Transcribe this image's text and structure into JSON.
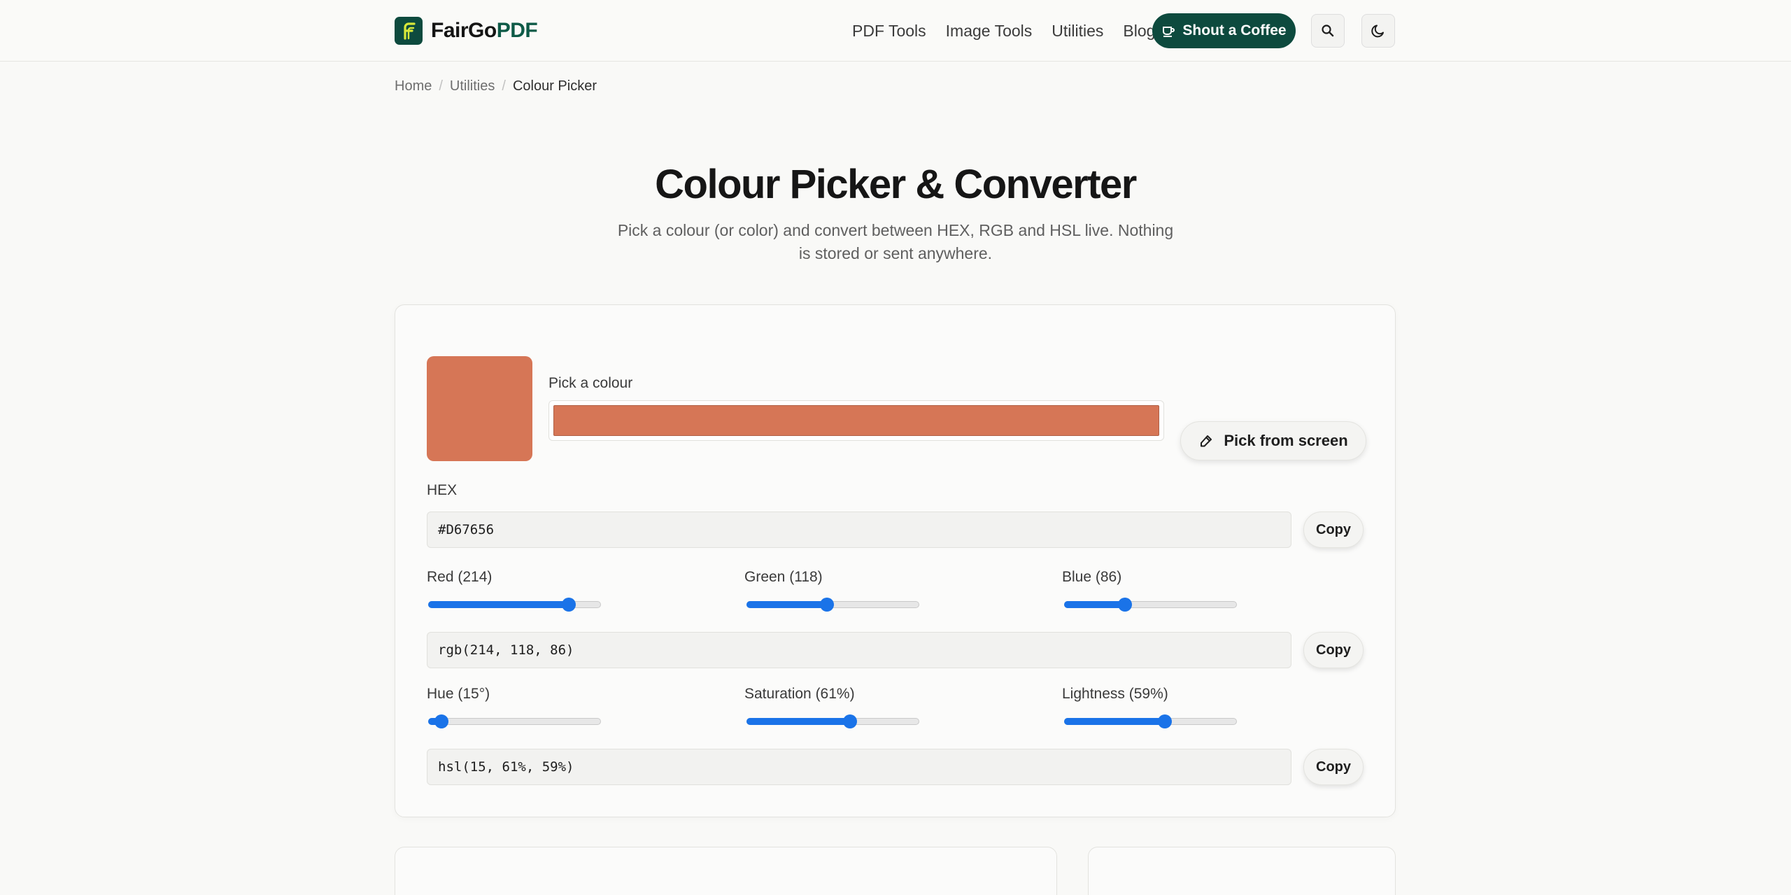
{
  "header": {
    "logo_fair": "FairGo",
    "logo_pdf": "PDF",
    "nav": [
      "PDF Tools",
      "Image Tools",
      "Utilities",
      "Blog"
    ],
    "coffee_label": "Shout a Coffee",
    "search_icon": "search-icon",
    "theme_icon": "moon-icon"
  },
  "breadcrumb": {
    "items": [
      "Home",
      "Utilities"
    ],
    "current": "Colour Picker",
    "separator": "/"
  },
  "hero": {
    "title": "Colour Picker & Converter",
    "subtitle": "Pick a colour (or color) and convert between HEX, RGB and HSL live. Nothing is stored or sent anywhere."
  },
  "picker": {
    "current_color": "#D67656",
    "pick_label": "Pick a colour",
    "pick_screen_label": "Pick from screen",
    "hex_label": "HEX",
    "hex_value": "#D67656",
    "rgb_value": "rgb(214, 118, 86)",
    "hsl_value": "hsl(15, 61%, 59%)",
    "copy_label": "Copy",
    "rgb_sliders": [
      {
        "label": "Red (214)",
        "value": 214,
        "max": 255
      },
      {
        "label": "Green (118)",
        "value": 118,
        "max": 255
      },
      {
        "label": "Blue (86)",
        "value": 86,
        "max": 255
      }
    ],
    "hsl_sliders": [
      {
        "label": "Hue (15°)",
        "value": 15,
        "max": 360
      },
      {
        "label": "Saturation (61%)",
        "value": 61,
        "max": 100
      },
      {
        "label": "Lightness (59%)",
        "value": 59,
        "max": 100
      }
    ]
  },
  "colors": {
    "brand": "#0d4a3e",
    "accent": "#1a73e8"
  }
}
